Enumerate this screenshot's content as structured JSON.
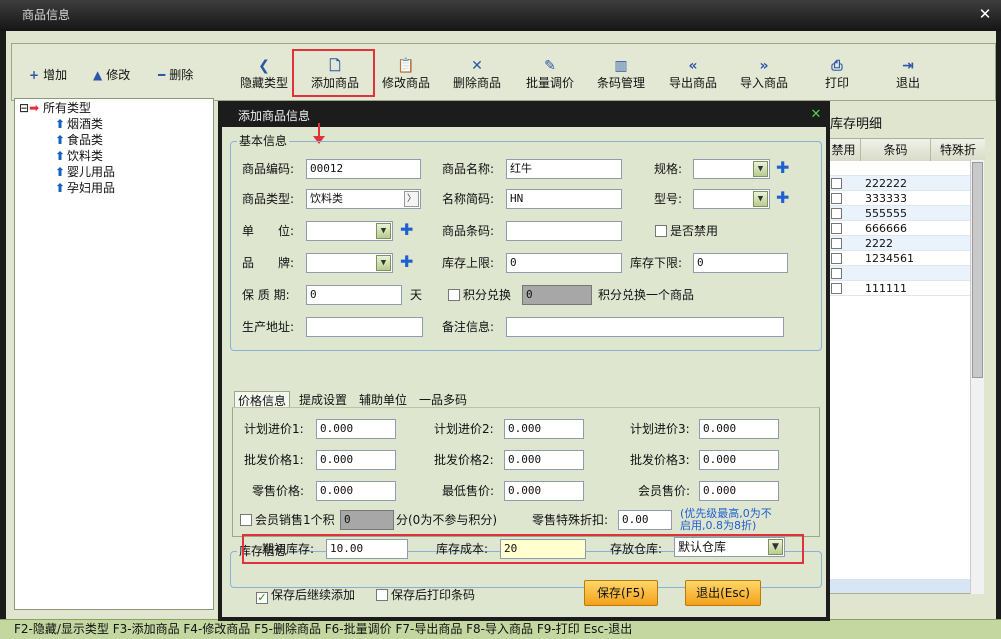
{
  "window": {
    "title": "商品信息",
    "close": "✕"
  },
  "side_buttons": [
    {
      "label": "增加",
      "icon": "+"
    },
    {
      "label": "修改",
      "icon": "▲"
    },
    {
      "label": "删除",
      "icon": "━"
    }
  ],
  "toolbar": [
    {
      "label": "隐藏类型",
      "icon": "❮"
    },
    {
      "label": "添加商品",
      "icon": "🗋"
    },
    {
      "label": "修改商品",
      "icon": "📋"
    },
    {
      "label": "删除商品",
      "icon": "✕"
    },
    {
      "label": "批量调价",
      "icon": "✎"
    },
    {
      "label": "条码管理",
      "icon": "▥"
    },
    {
      "label": "导出商品",
      "icon": "«"
    },
    {
      "label": "导入商品",
      "icon": "»"
    },
    {
      "label": "打印",
      "icon": "⎙"
    },
    {
      "label": "退出",
      "icon": "⇥"
    }
  ],
  "tree": {
    "root": "所有类型",
    "root_toggle": "⊟",
    "children": [
      "烟酒类",
      "食品类",
      "饮料类",
      "婴儿用品",
      "孕妇用品"
    ]
  },
  "right_panel": {
    "title": "库存明细",
    "headers": [
      "禁用",
      "条码",
      "特殊折"
    ],
    "barcodes": [
      "222222",
      "333333",
      "555555",
      "666666",
      "2222",
      "1234561",
      "",
      "111111"
    ]
  },
  "status": "F2-隐藏/显示类型  F3-添加商品  F4-修改商品  F5-删除商品  F6-批量调价  F7-导出商品  F8-导入商品  F9-打印  Esc-退出",
  "dialog": {
    "title": "添加商品信息",
    "close": "✕",
    "basic": {
      "legend": "基本信息",
      "code_label": "商品编码:",
      "code": "00012",
      "name_label": "商品名称:",
      "name": "红牛",
      "spec_label": "规格:",
      "type_label": "商品类型:",
      "type": "饮料类",
      "type_btn": "〉",
      "short_label": "名称简码:",
      "short": "HN",
      "model_label": "型号:",
      "unit_label": "单　　位:",
      "barcode_label": "商品条码:",
      "disabled_label": "是否禁用",
      "brand_label": "品　　牌:",
      "stock_max_label": "库存上限:",
      "stock_max": "0",
      "stock_min_label": "库存下限:",
      "stock_min": "0",
      "shelf_label": "保 质 期:",
      "shelf": "0",
      "shelf_unit": "天",
      "points_label": "积分兑换",
      "points_value": "0",
      "points_suffix": "积分兑换一个商品",
      "origin_label": "生产地址:",
      "remark_label": "备注信息:"
    },
    "tabs": [
      "价格信息",
      "提成设置",
      "辅助单位",
      "一品多码"
    ],
    "price": {
      "plan1_label": "计划进价1:",
      "plan1": "0.000",
      "plan2_label": "计划进价2:",
      "plan2": "0.000",
      "plan3_label": "计划进价3:",
      "plan3": "0.000",
      "whole1_label": "批发价格1:",
      "whole1": "0.000",
      "whole2_label": "批发价格2:",
      "whole2": "0.000",
      "whole3_label": "批发价格3:",
      "whole3": "0.000",
      "retail_label": "零售价格:",
      "retail": "0.000",
      "min_label": "最低售价:",
      "min": "0.000",
      "member_label": "会员售价:",
      "member": "0.000",
      "member_points_label": "会员销售1个积",
      "member_points": "0",
      "member_points_suffix": "分(0为不参与积分)",
      "discount_label": "零售特殊折扣:",
      "discount": "0.00",
      "note_line1": "(优先级最高,0为不",
      "note_line2": "启用,0.8为8折)"
    },
    "stock": {
      "legend": "库存信息",
      "init_label": "期初库存:",
      "init": "10.00",
      "cost_label": "库存成本:",
      "cost": "20",
      "warehouse_label": "存放仓库:",
      "warehouse": "默认仓库"
    },
    "continue_label": "保存后继续添加",
    "continue_checked": "✓",
    "print_label": "保存后打印条码",
    "save": "保存(F5)",
    "exit": "退出(Esc)"
  },
  "colors": {
    "highlight": "#e1313a",
    "accent": "#1f5fd0",
    "button": "#f4a11a"
  }
}
